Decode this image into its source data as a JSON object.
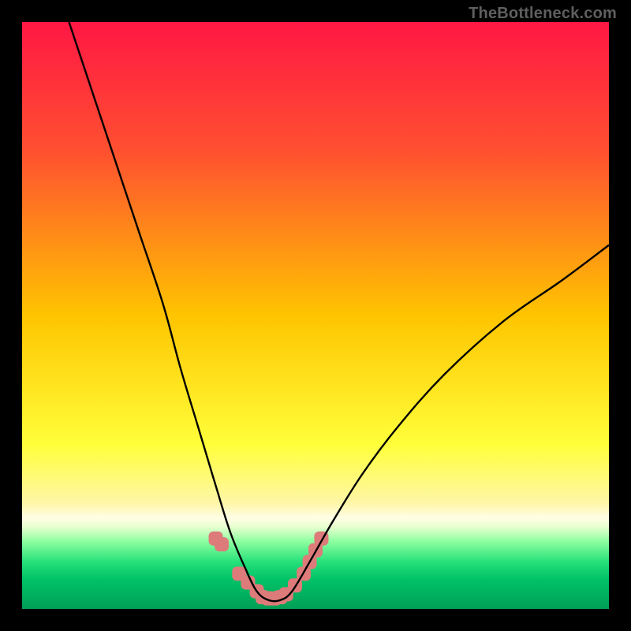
{
  "watermark": "TheBottleneck.com",
  "chart_data": {
    "type": "line",
    "title": "",
    "xlabel": "",
    "ylabel": "",
    "xlim": [
      0,
      100
    ],
    "ylim": [
      0,
      100
    ],
    "grid": false,
    "legend": false,
    "gradient_stops": [
      {
        "offset": 0,
        "color": "#ff1744"
      },
      {
        "offset": 0.22,
        "color": "#ff5030"
      },
      {
        "offset": 0.5,
        "color": "#ffc400"
      },
      {
        "offset": 0.72,
        "color": "#ffff3a"
      },
      {
        "offset": 0.82,
        "color": "#fff6a8"
      },
      {
        "offset": 0.845,
        "color": "#fffde6"
      },
      {
        "offset": 0.86,
        "color": "#e8ffd0"
      },
      {
        "offset": 0.885,
        "color": "#8dffa0"
      },
      {
        "offset": 0.92,
        "color": "#26e07a"
      },
      {
        "offset": 0.95,
        "color": "#00c267"
      },
      {
        "offset": 1.0,
        "color": "#009f55"
      }
    ],
    "series": [
      {
        "name": "curve",
        "x": [
          8,
          12,
          16,
          20,
          24,
          27,
          30,
          33,
          35.5,
          38,
          40,
          42,
          44,
          46,
          49,
          53,
          58,
          64,
          72,
          82,
          92,
          100
        ],
        "y": [
          100,
          88,
          76,
          64,
          52,
          41,
          31,
          21,
          13,
          7,
          3,
          1.5,
          1.5,
          3,
          8,
          15,
          23,
          31,
          40,
          49,
          56,
          62
        ]
      }
    ],
    "markers": {
      "name": "cluster",
      "color": "#dd7b7a",
      "x": [
        33,
        34,
        37,
        38.5,
        40,
        41,
        42,
        43,
        44,
        45,
        46.5,
        48,
        49,
        50,
        51
      ],
      "y": [
        12,
        11,
        6,
        4.5,
        3,
        2,
        1.8,
        1.8,
        2,
        2.5,
        4,
        6,
        8,
        10,
        12
      ]
    }
  }
}
